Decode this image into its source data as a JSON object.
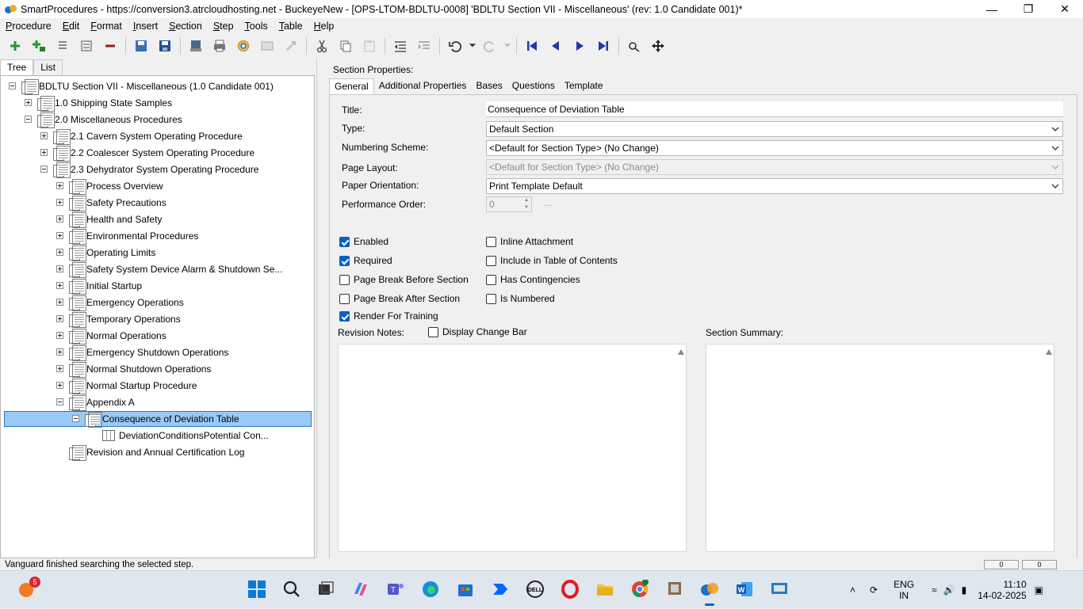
{
  "window": {
    "title": "SmartProcedures - https://conversion3.atrcloudhosting.net - BuckeyeNew - [OPS-LTOM-BDLTU-0008] 'BDLTU Section VII - Miscellaneous' (rev: 1.0 Candidate 001)*"
  },
  "menu": [
    "Procedure",
    "Edit",
    "Format",
    "Insert",
    "Section",
    "Step",
    "Tools",
    "Table",
    "Help"
  ],
  "left_tabs": [
    "Tree",
    "List"
  ],
  "tree": [
    {
      "label": "BDLTU Section VII - Miscellaneous (1.0 Candidate 001)",
      "level": 0,
      "exp": "minus",
      "icon": "doc"
    },
    {
      "label": "1.0 Shipping State Samples",
      "level": 1,
      "exp": "plus",
      "icon": "doc"
    },
    {
      "label": "2.0 Miscellaneous Procedures",
      "level": 1,
      "exp": "minus",
      "icon": "doc"
    },
    {
      "label": "2.1 Cavern System Operating Procedure",
      "level": 2,
      "exp": "plus",
      "icon": "doc"
    },
    {
      "label": "2.2 Coalescer System Operating Procedure",
      "level": 2,
      "exp": "plus",
      "icon": "doc"
    },
    {
      "label": "2.3 Dehydrator System Operating Procedure",
      "level": 2,
      "exp": "minus",
      "icon": "doc"
    },
    {
      "label": "Process Overview",
      "level": 3,
      "exp": "plus",
      "icon": "doc"
    },
    {
      "label": "Safety Precautions",
      "level": 3,
      "exp": "plus",
      "icon": "doc"
    },
    {
      "label": "Health and Safety",
      "level": 3,
      "exp": "plus",
      "icon": "doc"
    },
    {
      "label": "Environmental Procedures",
      "level": 3,
      "exp": "plus",
      "icon": "doc"
    },
    {
      "label": "Operating Limits",
      "level": 3,
      "exp": "plus",
      "icon": "doc"
    },
    {
      "label": "Safety System Device Alarm & Shutdown Se...",
      "level": 3,
      "exp": "plus",
      "icon": "doc"
    },
    {
      "label": "Initial Startup",
      "level": 3,
      "exp": "plus",
      "icon": "doc"
    },
    {
      "label": "Emergency Operations",
      "level": 3,
      "exp": "plus",
      "icon": "doc"
    },
    {
      "label": "Temporary Operations",
      "level": 3,
      "exp": "plus",
      "icon": "doc"
    },
    {
      "label": "Normal Operations",
      "level": 3,
      "exp": "plus",
      "icon": "doc"
    },
    {
      "label": "Emergency Shutdown Operations",
      "level": 3,
      "exp": "plus",
      "icon": "doc"
    },
    {
      "label": "Normal Shutdown Operations",
      "level": 3,
      "exp": "plus",
      "icon": "doc"
    },
    {
      "label": "Normal Startup Procedure",
      "level": 3,
      "exp": "plus",
      "icon": "doc"
    },
    {
      "label": "Appendix A",
      "level": 3,
      "exp": "minus",
      "icon": "doc"
    },
    {
      "label": "Consequence of Deviation Table",
      "level": 4,
      "exp": "minus",
      "icon": "doc",
      "selected": true
    },
    {
      "label": "DeviationConditionsPotential Con...",
      "level": 5,
      "exp": "none",
      "icon": "table"
    },
    {
      "label": "Revision and Annual Certification Log",
      "level": 3,
      "exp": "none",
      "icon": "doc"
    }
  ],
  "right": {
    "header": "Section Properties:",
    "tabs": [
      "General",
      "Additional Properties",
      "Bases",
      "Questions",
      "Template"
    ],
    "fields": {
      "title_label": "Title:",
      "title_value": "Consequence of Deviation Table",
      "type_label": "Type:",
      "type_value": "Default Section",
      "numbering_label": "Numbering Scheme:",
      "numbering_value": "<Default for Section Type> (No Change)",
      "layout_label": "Page Layout:",
      "layout_value": "<Default for Section Type> (No Change)",
      "orientation_label": "Paper Orientation:",
      "orientation_value": "Print Template Default",
      "perf_label": "Performance Order:",
      "perf_value": "0",
      "ellipsis": "..."
    },
    "checkboxes": {
      "enabled": {
        "label": "Enabled",
        "checked": true
      },
      "required": {
        "label": "Required",
        "checked": true
      },
      "page_break_before": {
        "label": "Page Break Before Section",
        "checked": false
      },
      "page_break_after": {
        "label": "Page Break After Section",
        "checked": false
      },
      "render_training": {
        "label": "Render For Training",
        "checked": true
      },
      "inline_attachment": {
        "label": "Inline Attachment",
        "checked": false
      },
      "include_toc": {
        "label": "Include in Table of Contents",
        "checked": false
      },
      "has_contingencies": {
        "label": "Has Contingencies",
        "checked": false
      },
      "is_numbered": {
        "label": "Is Numbered",
        "checked": false
      },
      "display_change_bar": {
        "label": "Display Change Bar",
        "checked": false
      }
    },
    "revision_notes_label": "Revision Notes:",
    "section_summary_label": "Section Summary:"
  },
  "status": {
    "text": "Vanguard finished searching the selected step.",
    "box1": "0",
    "box2": "0"
  },
  "taskbar": {
    "notification_count": "5",
    "lang": "ENG",
    "region": "IN",
    "time": "11:10",
    "date": "14-02-2025"
  },
  "colors": {
    "accent": "#0a5fc7",
    "selection": "#99c9f5",
    "nav_arrow": "#1e3aa8"
  }
}
